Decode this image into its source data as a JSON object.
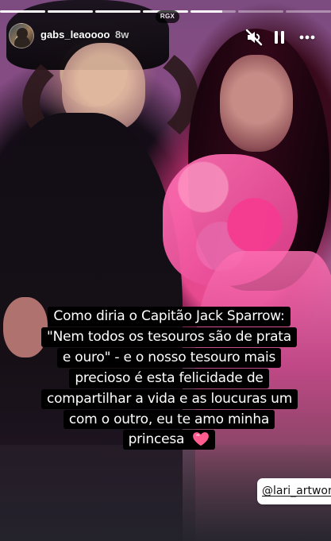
{
  "story": {
    "watermark": "RGX",
    "progress": [
      1,
      1,
      1,
      1,
      0.7,
      0,
      0
    ]
  },
  "header": {
    "username": "gabs_leaoooo",
    "time": "8w",
    "icons": [
      "mute-icon",
      "pause-icon",
      "more-icon"
    ]
  },
  "caption": {
    "lines": [
      "Como diria o Capitão Jack Sparrow:",
      "\"Nem todos os tesouros são de prata",
      "e ouro\" - e o nosso tesouro mais",
      "precioso é esta felicidade de",
      "compartilhar a vida e as loucuras um",
      "com o outro, eu te amo minha",
      "princesa"
    ],
    "emoji_icon": "pink-heart-icon"
  },
  "mention": {
    "label": "@lari_artwor"
  },
  "colors": {
    "heart": "#ff5d8f",
    "caption_background": "#000000",
    "mention_background": "#ffffff"
  }
}
